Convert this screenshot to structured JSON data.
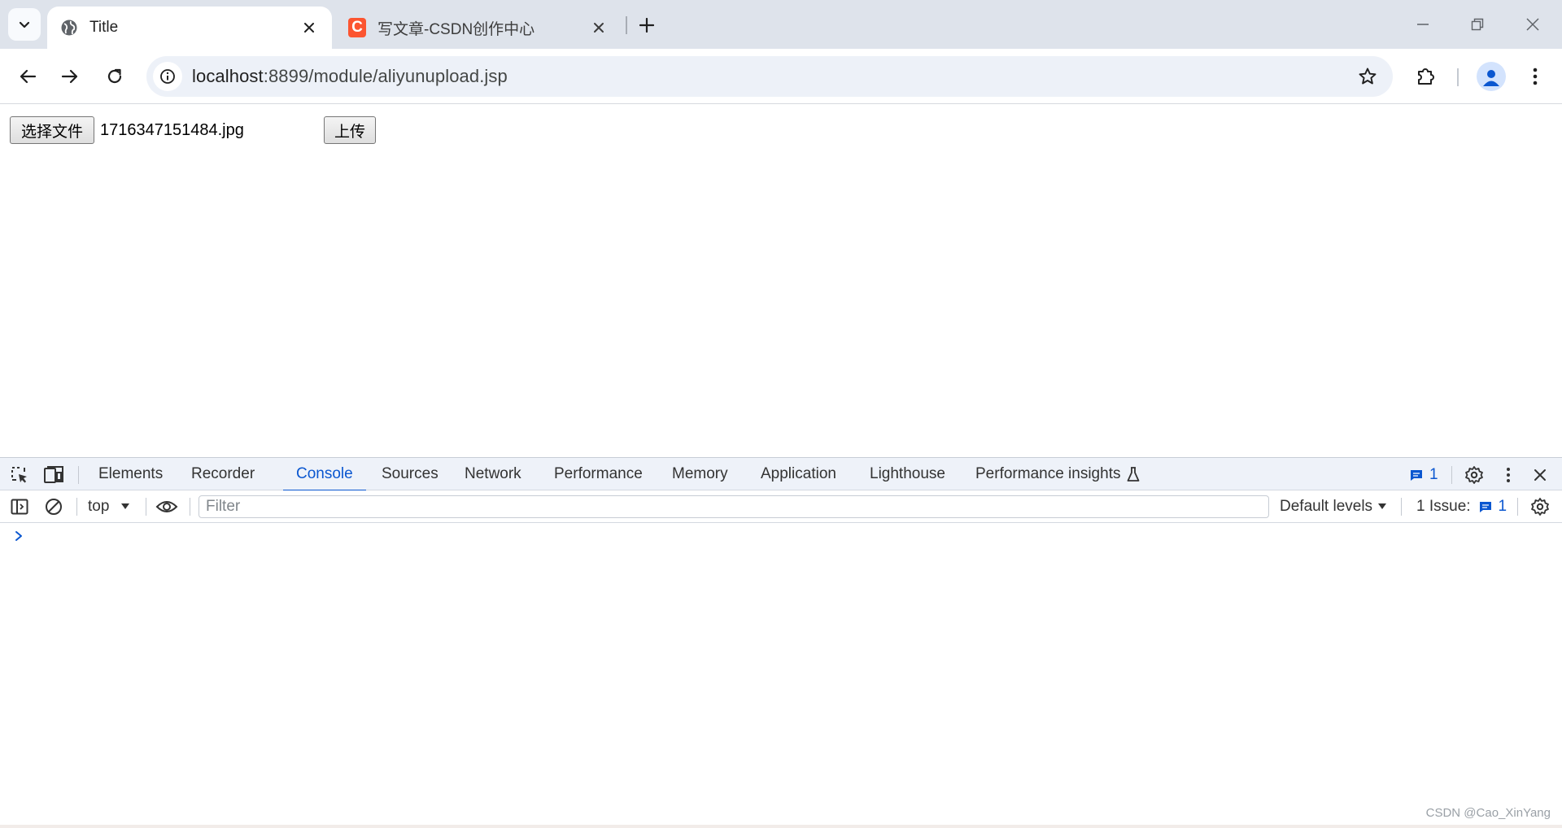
{
  "browser": {
    "tabs": [
      {
        "title": "Title",
        "favicon": "globe-icon",
        "active": true
      },
      {
        "title": "写文章-CSDN创作中心",
        "favicon": "csdn-logo-icon",
        "favicon_glyph": "C",
        "favicon_color": "#fc5531",
        "active": false
      }
    ],
    "address": {
      "host": "localhost",
      "rest": ":8899/module/aliyunupload.jsp"
    }
  },
  "page": {
    "file_button_label": "选择文件",
    "file_name": "1716347151484.jpg",
    "upload_button_label": "上传"
  },
  "devtools": {
    "tabs": [
      "Elements",
      "Recorder",
      "Console",
      "Sources",
      "Network",
      "Performance",
      "Memory",
      "Application",
      "Lighthouse",
      "Performance insights"
    ],
    "active_tab": "Console",
    "message_badge_count": "1",
    "context": "top",
    "filter_placeholder": "Filter",
    "levels_label": "Default levels",
    "issues_label": "1 Issue:",
    "issues_count": "1",
    "accent_color": "#0b57d0"
  },
  "watermark": "CSDN @Cao_XinYang"
}
